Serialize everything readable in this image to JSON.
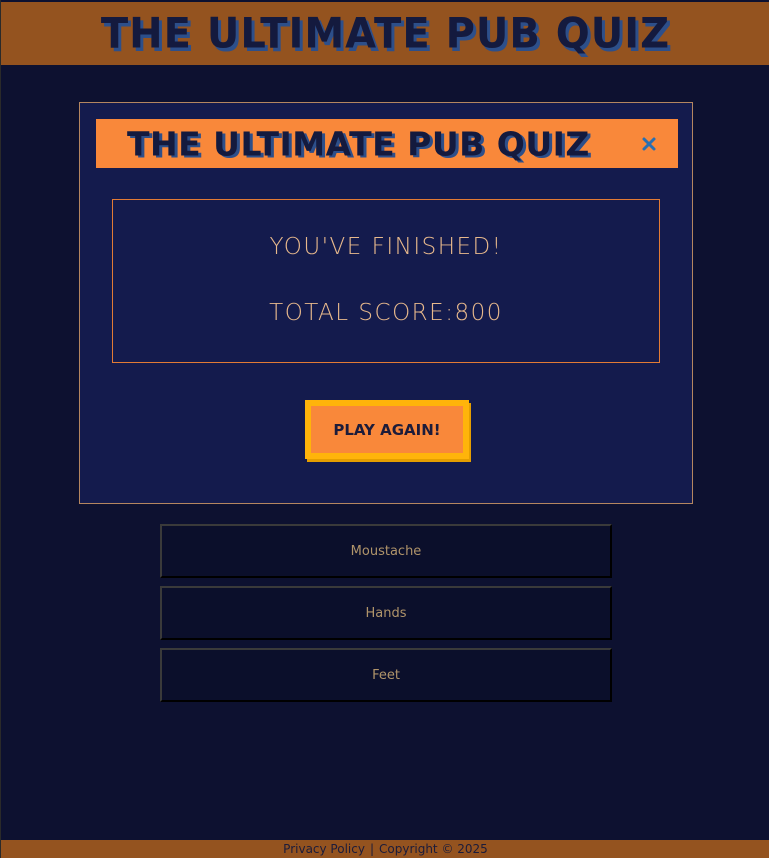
{
  "header": {
    "title": "THE ULTIMATE PUB QUIZ"
  },
  "modal": {
    "title": "THE ULTIMATE PUB QUIZ",
    "close_icon": "close-icon",
    "finished_text": "YOU'VE FINISHED!",
    "score_label": "TOTAL SCORE:",
    "score_value": "800",
    "play_again_label": "PLAY AGAIN!"
  },
  "answers": [
    {
      "label": "Moustache"
    },
    {
      "label": "Hands"
    },
    {
      "label": "Feet"
    }
  ],
  "footer": {
    "privacy_label": "Privacy Policy",
    "separator": "|",
    "copyright": "Copyright © 2025"
  },
  "colors": {
    "background": "#0d1130",
    "header_bg": "#94531f",
    "modal_bg": "#141b4d",
    "accent_orange": "#f9883a",
    "button_border": "#ffb40a",
    "text_gold": "#e8b98c",
    "close_icon": "#2a6fb0"
  }
}
